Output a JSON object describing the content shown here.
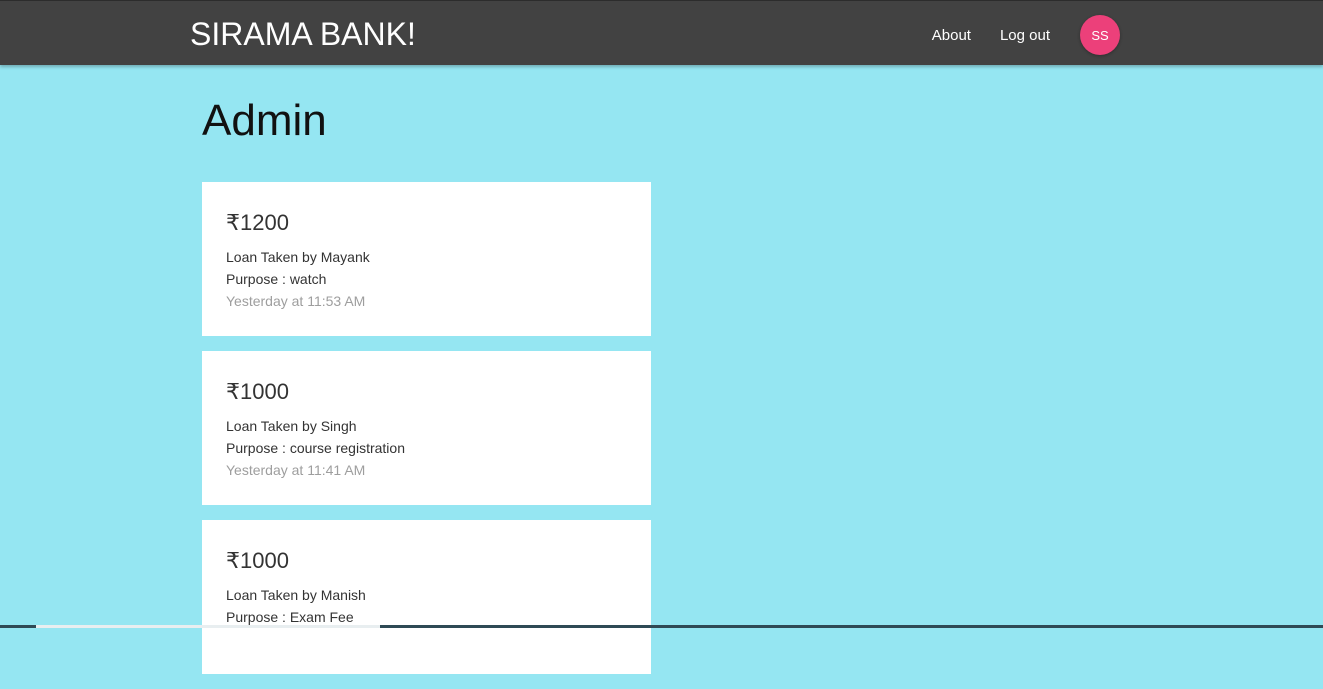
{
  "navbar": {
    "brand": "SIRAMA BANK!",
    "links": [
      "About",
      "Log out"
    ],
    "avatar_initials": "SS",
    "background": "#424242",
    "avatar_color": "#ec407a"
  },
  "page": {
    "title": "Admin",
    "background": "#95e6f2"
  },
  "loans": [
    {
      "amount": "₹1200",
      "taken_by": "Loan Taken by Mayank",
      "purpose": "Purpose : watch",
      "time": "Yesterday at 11:53 AM"
    },
    {
      "amount": "₹1000",
      "taken_by": "Loan Taken by Singh",
      "purpose": "Purpose : course registration",
      "time": "Yesterday at 11:41 AM"
    },
    {
      "amount": "₹1000",
      "taken_by": "Loan Taken by Manish",
      "purpose": "Purpose : Exam Fee",
      "time": ""
    }
  ]
}
